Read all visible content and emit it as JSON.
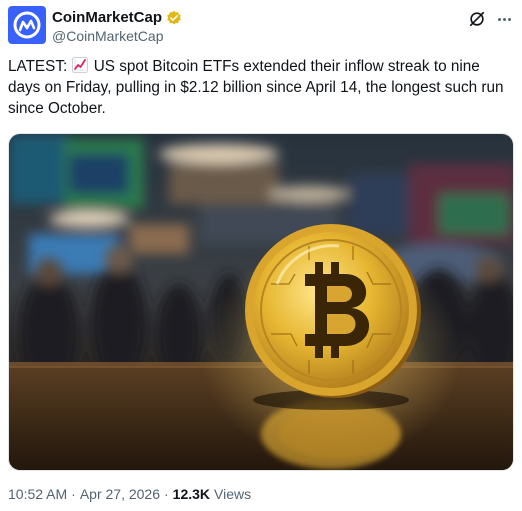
{
  "author": {
    "display_name": "CoinMarketCap",
    "handle": "@CoinMarketCap",
    "avatar_icon": "coinmarketcap-logo-icon",
    "verified_icon": "gold-verified-badge-icon",
    "brand_color": "#3861fb",
    "verified_color": "#e2b719"
  },
  "actions": {
    "grok_icon": "grok-icon",
    "more_icon": "more-icon"
  },
  "tweet": {
    "text_before_emoji": "LATEST: ",
    "emoji_icon": "chart-increasing-icon",
    "text_after_emoji": " US spot Bitcoin ETFs extended their inflow streak to nine days on Friday, pulling in $2.12 billion since April 14, the longest such run since October."
  },
  "media": {
    "image_subject": "bitcoin-coin-on-trading-floor-photo"
  },
  "meta": {
    "time": "10:52 AM",
    "separator": "·",
    "date": "Apr 27, 2026",
    "separator2": "·",
    "views_count": "12.3K",
    "views_label": "Views"
  },
  "colors": {
    "text_primary": "#0f1419",
    "text_secondary": "#536471"
  }
}
